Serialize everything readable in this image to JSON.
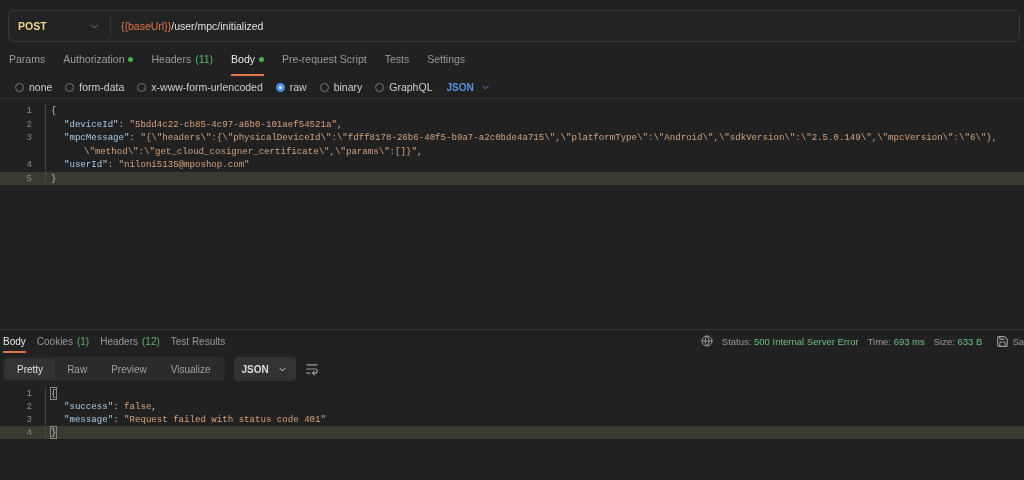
{
  "request": {
    "method": "POST",
    "url_variable": "{{baseUrl}}",
    "url_path": "/user/mpc/initialized"
  },
  "request_tabs": [
    {
      "label": "Params",
      "selected": false
    },
    {
      "label": "Authorization",
      "dot": true,
      "selected": false
    },
    {
      "label": "Headers",
      "count": "(11)",
      "selected": false
    },
    {
      "label": "Body",
      "dot": true,
      "selected": true
    },
    {
      "label": "Pre-request Script",
      "selected": false
    },
    {
      "label": "Tests",
      "selected": false
    },
    {
      "label": "Settings",
      "selected": false
    }
  ],
  "body_types": [
    {
      "label": "none",
      "selected": false
    },
    {
      "label": "form-data",
      "selected": false
    },
    {
      "label": "x-www-form-urlencoded",
      "selected": false
    },
    {
      "label": "raw",
      "selected": true
    },
    {
      "label": "binary",
      "selected": false
    },
    {
      "label": "GraphQL",
      "selected": false
    }
  ],
  "body_language": "JSON",
  "request_body": [
    {
      "number": "1",
      "indented": false,
      "current": false,
      "tokens": [
        {
          "kind": "punct",
          "text": "{"
        }
      ]
    },
    {
      "number": "2",
      "indented": true,
      "current": false,
      "tokens": [
        {
          "kind": "key",
          "text": "\"deviceId\""
        },
        {
          "kind": "punct",
          "text": ": "
        },
        {
          "kind": "string",
          "text": "\"5bdd4c22-cb85-4c97-a6b0-101aef54521a\""
        },
        {
          "kind": "punct",
          "text": ","
        }
      ]
    },
    {
      "number": "3",
      "indented": true,
      "current": false,
      "tokens": [
        {
          "kind": "key",
          "text": "\"mpcMessage\""
        },
        {
          "kind": "punct",
          "text": ": "
        },
        {
          "kind": "string",
          "text": "\"{\\\"headers\\\":{\\\"physicalDeviceId\\\":\\\"fdff8178-26b6-40f5-b9a7-a2c0bde4a715\\\",\\\"platformType\\\":\\\"Android\\\",\\\"sdkVersion\\\":\\\"2.5.0.149\\\",\\\"mpcVersion\\\":\\\"6\\\"},"
        }
      ],
      "continuation": [
        {
          "kind": "string",
          "text": "\\\"method\\\":\\\"get_cloud_cosigner_certificate\\\",\\\"params\\\":[]}\""
        },
        {
          "kind": "punct",
          "text": ","
        }
      ]
    },
    {
      "number": "4",
      "indented": true,
      "current": false,
      "tokens": [
        {
          "kind": "key",
          "text": "\"userId\""
        },
        {
          "kind": "punct",
          "text": ": "
        },
        {
          "kind": "string",
          "text": "\"niloni5135@mposhop.com\""
        }
      ]
    },
    {
      "number": "5",
      "indented": false,
      "current": true,
      "tokens": [
        {
          "kind": "punct",
          "text": "}"
        }
      ]
    }
  ],
  "response_tabs": [
    {
      "label": "Body",
      "selected": true
    },
    {
      "label": "Cookies",
      "count": "(1)",
      "selected": false
    },
    {
      "label": "Headers",
      "count": "(12)",
      "selected": false
    },
    {
      "label": "Test Results",
      "selected": false
    }
  ],
  "response_status": {
    "status_label": "Status:",
    "status": "500 Internal Server Error",
    "time_label": "Time:",
    "time": "693 ms",
    "size_label": "Size:",
    "size": "633 B",
    "save": "Sa"
  },
  "view_modes": [
    {
      "label": "Pretty",
      "selected": true
    },
    {
      "label": "Raw",
      "selected": false
    },
    {
      "label": "Preview",
      "selected": false
    },
    {
      "label": "Visualize",
      "selected": false
    }
  ],
  "response_format": "JSON",
  "response_body": [
    {
      "number": "1",
      "indented": false,
      "current": false,
      "tokens": [
        {
          "kind": "bracket",
          "text": "{"
        }
      ]
    },
    {
      "number": "2",
      "indented": true,
      "current": false,
      "tokens": [
        {
          "kind": "key",
          "text": "\"success\""
        },
        {
          "kind": "punct",
          "text": ": "
        },
        {
          "kind": "bool",
          "text": "false"
        },
        {
          "kind": "punct",
          "text": ","
        }
      ]
    },
    {
      "number": "3",
      "indented": true,
      "current": false,
      "tokens": [
        {
          "kind": "key",
          "text": "\"message\""
        },
        {
          "kind": "punct",
          "text": ": "
        },
        {
          "kind": "string",
          "text": "\"Request failed with status code 401\""
        }
      ]
    },
    {
      "number": "4",
      "indented": false,
      "current": true,
      "tokens": [
        {
          "kind": "bracket",
          "text": "}"
        }
      ]
    }
  ]
}
